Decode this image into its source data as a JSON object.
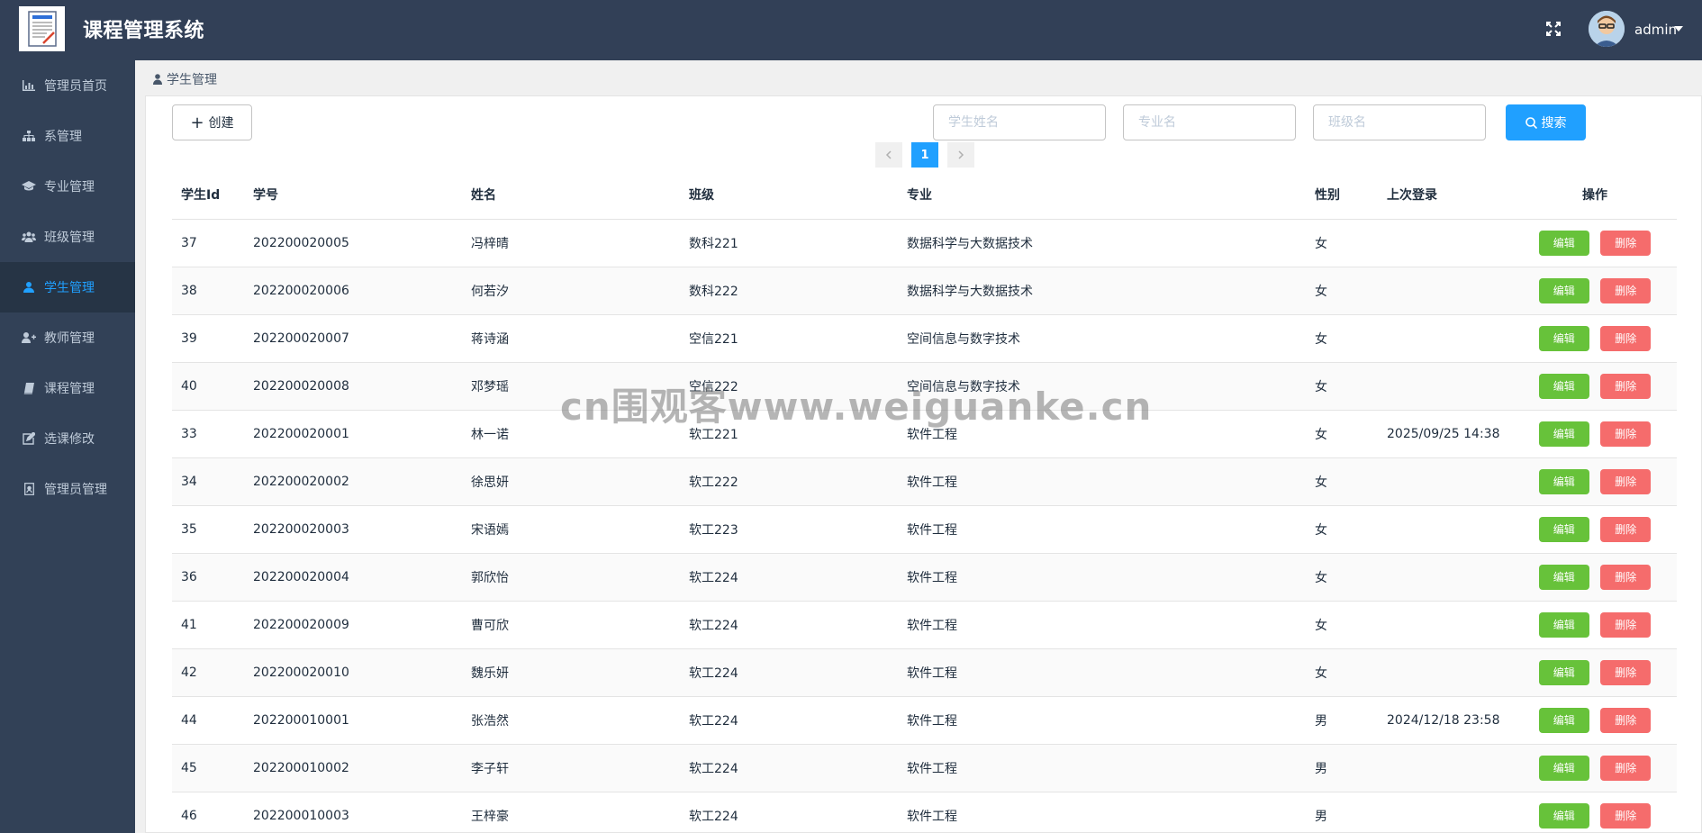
{
  "header": {
    "app_title": "课程管理系统",
    "user_name": "admin",
    "brand_color": "#324057"
  },
  "sidebar": {
    "items": [
      {
        "label": "管理员首页",
        "icon": "bar-chart-icon"
      },
      {
        "label": "系管理",
        "icon": "sitemap-icon"
      },
      {
        "label": "专业管理",
        "icon": "graduation-cap-icon"
      },
      {
        "label": "班级管理",
        "icon": "group-icon"
      },
      {
        "label": "学生管理",
        "icon": "user-icon",
        "active": true
      },
      {
        "label": "教师管理",
        "icon": "user-plus-icon"
      },
      {
        "label": "课程管理",
        "icon": "book-icon"
      },
      {
        "label": "选课修改",
        "icon": "edit-icon"
      },
      {
        "label": "管理员管理",
        "icon": "badge-icon"
      }
    ]
  },
  "breadcrumb": {
    "label": "学生管理"
  },
  "toolbar": {
    "create_label": "创建",
    "search_label": "搜索",
    "student_name_placeholder": "学生姓名",
    "major_placeholder": "专业名",
    "class_placeholder": "班级名"
  },
  "pager": {
    "current": "1"
  },
  "table": {
    "columns": {
      "id": "学生Id",
      "no": "学号",
      "name": "姓名",
      "class": "班级",
      "major": "专业",
      "gender": "性别",
      "last_login": "上次登录",
      "ops": "操作"
    },
    "edit_label": "编辑",
    "delete_label": "删除",
    "rows": [
      {
        "id": "37",
        "no": "202200020005",
        "name": "冯梓晴",
        "class": "数科221",
        "major": "数据科学与大数据技术",
        "gender": "女",
        "last_login": ""
      },
      {
        "id": "38",
        "no": "202200020006",
        "name": "何若汐",
        "class": "数科222",
        "major": "数据科学与大数据技术",
        "gender": "女",
        "last_login": ""
      },
      {
        "id": "39",
        "no": "202200020007",
        "name": "蒋诗涵",
        "class": "空信221",
        "major": "空间信息与数字技术",
        "gender": "女",
        "last_login": ""
      },
      {
        "id": "40",
        "no": "202200020008",
        "name": "邓梦瑶",
        "class": "空信222",
        "major": "空间信息与数字技术",
        "gender": "女",
        "last_login": ""
      },
      {
        "id": "33",
        "no": "202200020001",
        "name": "林一诺",
        "class": "软工221",
        "major": "软件工程",
        "gender": "女",
        "last_login": "2025/09/25 14:38"
      },
      {
        "id": "34",
        "no": "202200020002",
        "name": "徐思妍",
        "class": "软工222",
        "major": "软件工程",
        "gender": "女",
        "last_login": ""
      },
      {
        "id": "35",
        "no": "202200020003",
        "name": "宋语嫣",
        "class": "软工223",
        "major": "软件工程",
        "gender": "女",
        "last_login": ""
      },
      {
        "id": "36",
        "no": "202200020004",
        "name": "郭欣怡",
        "class": "软工224",
        "major": "软件工程",
        "gender": "女",
        "last_login": ""
      },
      {
        "id": "41",
        "no": "202200020009",
        "name": "曹可欣",
        "class": "软工224",
        "major": "软件工程",
        "gender": "女",
        "last_login": ""
      },
      {
        "id": "42",
        "no": "202200020010",
        "name": "魏乐妍",
        "class": "软工224",
        "major": "软件工程",
        "gender": "女",
        "last_login": ""
      },
      {
        "id": "44",
        "no": "202200010001",
        "name": "张浩然",
        "class": "软工224",
        "major": "软件工程",
        "gender": "男",
        "last_login": "2024/12/18 23:58"
      },
      {
        "id": "45",
        "no": "202200010002",
        "name": "李子轩",
        "class": "软工224",
        "major": "软件工程",
        "gender": "男",
        "last_login": ""
      },
      {
        "id": "46",
        "no": "202200010003",
        "name": "王梓豪",
        "class": "软工224",
        "major": "软件工程",
        "gender": "男",
        "last_login": ""
      }
    ]
  },
  "watermark": "cn围观客www.weiguanke.cn"
}
